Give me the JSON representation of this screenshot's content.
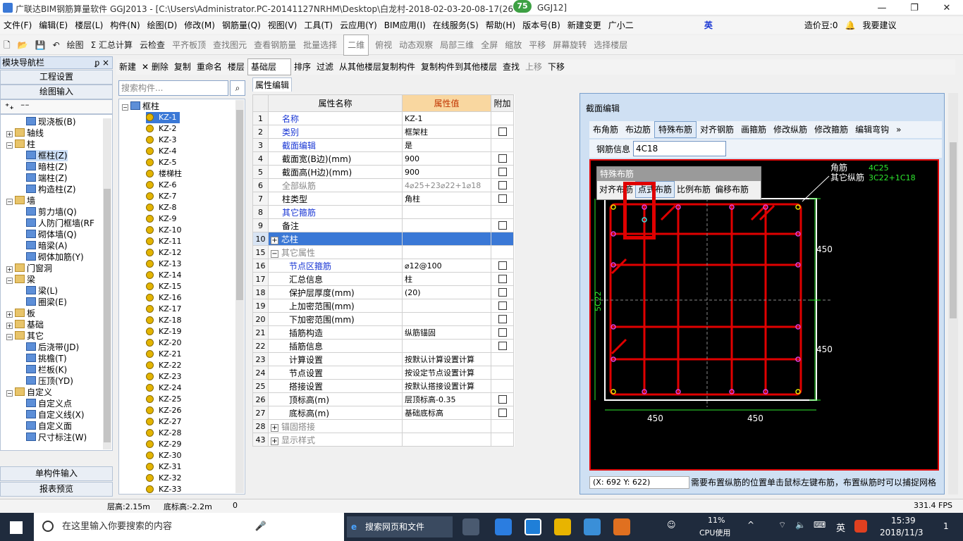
{
  "window": {
    "title": "广联达BIM钢筋算量软件 GGJ2013 - [C:\\Users\\Administrator.PC-20141127NRHM\\Desktop\\白龙村-2018-02-03-20-08-17(26",
    "title_tail": "GGJ12]",
    "badge": "75",
    "minimize": "—",
    "restore": "❐",
    "close": "✕"
  },
  "menu": [
    "文件(F)",
    "编辑(E)",
    "楼层(L)",
    "构件(N)",
    "绘图(D)",
    "修改(M)",
    "钢筋量(Q)",
    "视图(V)",
    "工具(T)",
    "云应用(Y)",
    "BIM应用(I)",
    "在线服务(S)",
    "帮助(H)",
    "版本号(B)",
    "新建变更",
    "广小二"
  ],
  "menu_right": {
    "ime": "英",
    "zao_jia_dou": "造价豆:0",
    "suggest": "我要建议"
  },
  "toolbar1": [
    "绘图",
    "Σ 汇总计算",
    "云检查",
    "平齐板顶",
    "查找图元",
    "查看钢筋量",
    "批量选择",
    "二维",
    "俯视",
    "动态观察",
    "局部三维",
    "全屏",
    "缩放",
    "平移",
    "屏幕旋转",
    "选择楼层"
  ],
  "left_panel": {
    "title": "模块导航栏",
    "pin": "ᵱ ×",
    "btn_project": "工程设置",
    "btn_draw": "绘图输入",
    "btn_single": "单构件输入",
    "btn_report": "报表预览",
    "tree": [
      {
        "label": "现浇板(B)",
        "indent": 2,
        "icon": "blue"
      },
      {
        "label": "轴线",
        "indent": 0,
        "toggle": "+",
        "icon": "folder"
      },
      {
        "label": "柱",
        "indent": 0,
        "toggle": "-",
        "icon": "folder"
      },
      {
        "label": "框柱(Z)",
        "indent": 2,
        "icon": "blue",
        "selected": true
      },
      {
        "label": "暗柱(Z)",
        "indent": 2,
        "icon": "blue"
      },
      {
        "label": "端柱(Z)",
        "indent": 2,
        "icon": "blue"
      },
      {
        "label": "构造柱(Z)",
        "indent": 2,
        "icon": "blue"
      },
      {
        "label": "墙",
        "indent": 0,
        "toggle": "-",
        "icon": "folder"
      },
      {
        "label": "剪力墙(Q)",
        "indent": 2,
        "icon": "blue"
      },
      {
        "label": "人防门框墙(RF",
        "indent": 2,
        "icon": "blue"
      },
      {
        "label": "砌体墙(Q)",
        "indent": 2,
        "icon": "blue"
      },
      {
        "label": "暗梁(A)",
        "indent": 2,
        "icon": "blue"
      },
      {
        "label": "砌体加筋(Y)",
        "indent": 2,
        "icon": "blue"
      },
      {
        "label": "门窗洞",
        "indent": 0,
        "toggle": "+",
        "icon": "folder"
      },
      {
        "label": "梁",
        "indent": 0,
        "toggle": "-",
        "icon": "folder"
      },
      {
        "label": "梁(L)",
        "indent": 2,
        "icon": "blue"
      },
      {
        "label": "圈梁(E)",
        "indent": 2,
        "icon": "blue"
      },
      {
        "label": "板",
        "indent": 0,
        "toggle": "+",
        "icon": "folder"
      },
      {
        "label": "基础",
        "indent": 0,
        "toggle": "+",
        "icon": "folder"
      },
      {
        "label": "其它",
        "indent": 0,
        "toggle": "-",
        "icon": "folder"
      },
      {
        "label": "后浇带(JD)",
        "indent": 2,
        "icon": "blue"
      },
      {
        "label": "挑檐(T)",
        "indent": 2,
        "icon": "blue"
      },
      {
        "label": "栏板(K)",
        "indent": 2,
        "icon": "blue"
      },
      {
        "label": "压顶(YD)",
        "indent": 2,
        "icon": "blue"
      },
      {
        "label": "自定义",
        "indent": 0,
        "toggle": "-",
        "icon": "folder"
      },
      {
        "label": "自定义点",
        "indent": 2,
        "icon": "blue"
      },
      {
        "label": "自定义线(X)",
        "indent": 2,
        "icon": "blue"
      },
      {
        "label": "自定义面",
        "indent": 2,
        "icon": "blue"
      },
      {
        "label": "尺寸标注(W)",
        "indent": 2,
        "icon": "blue"
      }
    ]
  },
  "toolbar2": [
    "新建",
    "✕ 删除",
    "复制",
    "重命名",
    "楼层",
    "基础层",
    "排序",
    "过滤",
    "从其他楼层复制构件",
    "复制构件到其他楼层",
    "查找",
    "上移",
    "下移"
  ],
  "component_search": {
    "placeholder": "搜索构件..."
  },
  "component_tree": {
    "root": "框柱",
    "items": [
      "KZ-1",
      "KZ-2",
      "KZ-3",
      "KZ-4",
      "KZ-5",
      "楼梯柱",
      "KZ-6",
      "KZ-7",
      "KZ-8",
      "KZ-9",
      "KZ-10",
      "KZ-11",
      "KZ-12",
      "KZ-13",
      "KZ-14",
      "KZ-15",
      "KZ-16",
      "KZ-17",
      "KZ-18",
      "KZ-19",
      "KZ-20",
      "KZ-21",
      "KZ-22",
      "KZ-23",
      "KZ-24",
      "KZ-25",
      "KZ-26",
      "KZ-27",
      "KZ-28",
      "KZ-29",
      "KZ-30",
      "KZ-31",
      "KZ-32",
      "KZ-33"
    ],
    "selected": "KZ-1"
  },
  "property_tab": "属性编辑",
  "property_table": {
    "headers": {
      "name": "属性名称",
      "value": "属性值",
      "extra": "附加"
    },
    "rows": [
      {
        "n": "1",
        "name": "名称",
        "value": "KZ-1",
        "style": "lk",
        "cb": false
      },
      {
        "n": "2",
        "name": "类别",
        "value": "框架柱",
        "style": "lk",
        "cb": true
      },
      {
        "n": "3",
        "name": "截面编辑",
        "value": "是",
        "style": "lk",
        "cb": false
      },
      {
        "n": "4",
        "name": "截面宽(B边)(mm)",
        "value": "900",
        "style": "",
        "cb": true
      },
      {
        "n": "5",
        "name": "截面高(H边)(mm)",
        "value": "900",
        "style": "",
        "cb": true
      },
      {
        "n": "6",
        "name": "全部纵筋",
        "value": "4⌀25+23⌀22+1⌀18",
        "style": "gr",
        "cb": true
      },
      {
        "n": "7",
        "name": "柱类型",
        "value": "角柱",
        "style": "",
        "cb": true
      },
      {
        "n": "8",
        "name": "其它箍筋",
        "value": "",
        "style": "lk",
        "cb": false
      },
      {
        "n": "9",
        "name": "备注",
        "value": "",
        "style": "",
        "cb": true
      },
      {
        "n": "10",
        "name": "芯柱",
        "value": "",
        "style": "hl",
        "plus": "+",
        "cb": false
      },
      {
        "n": "15",
        "name": "其它属性",
        "value": "",
        "style": "gr",
        "plus": "−",
        "cb": false
      },
      {
        "n": "16",
        "name": "节点区箍筋",
        "value": "⌀12@100",
        "style": "lk",
        "indent": true,
        "cb": true
      },
      {
        "n": "17",
        "name": "汇总信息",
        "value": "柱",
        "style": "",
        "indent": true,
        "cb": true
      },
      {
        "n": "18",
        "name": "保护层厚度(mm)",
        "value": "(20)",
        "style": "",
        "indent": true,
        "cb": true
      },
      {
        "n": "19",
        "name": "上加密范围(mm)",
        "value": "",
        "style": "",
        "indent": true,
        "cb": true
      },
      {
        "n": "20",
        "name": "下加密范围(mm)",
        "value": "",
        "style": "",
        "indent": true,
        "cb": true
      },
      {
        "n": "21",
        "name": "插筋构造",
        "value": "纵筋锚固",
        "style": "",
        "indent": true,
        "cb": true
      },
      {
        "n": "22",
        "name": "插筋信息",
        "value": "",
        "style": "",
        "indent": true,
        "cb": true
      },
      {
        "n": "23",
        "name": "计算设置",
        "value": "按默认计算设置计算",
        "style": "",
        "indent": true,
        "cb": false
      },
      {
        "n": "24",
        "name": "节点设置",
        "value": "按设定节点设置计算",
        "style": "",
        "indent": true,
        "cb": false
      },
      {
        "n": "25",
        "name": "搭接设置",
        "value": "按默认搭接设置计算",
        "style": "",
        "indent": true,
        "cb": false
      },
      {
        "n": "26",
        "name": "顶标高(m)",
        "value": "层顶标高-0.35",
        "style": "",
        "indent": true,
        "cb": true
      },
      {
        "n": "27",
        "name": "底标高(m)",
        "value": "基础底标高",
        "style": "",
        "indent": true,
        "cb": true
      },
      {
        "n": "28",
        "name": "锚固搭接",
        "value": "",
        "style": "gr",
        "plus": "+",
        "cb": false
      },
      {
        "n": "43",
        "name": "显示样式",
        "value": "",
        "style": "gr",
        "plus": "+",
        "cb": false
      }
    ]
  },
  "section_editor": {
    "title": "截面编辑",
    "tools": [
      "布角筋",
      "布边筋",
      "特殊布筋",
      "对齐钢筋",
      "画箍筋",
      "修改纵筋",
      "修改箍筋",
      "编辑弯钩"
    ],
    "active_tool": "特殊布筋",
    "rebar_label": "钢筋信息",
    "rebar_value": "4C18",
    "popup_title": "特殊布筋",
    "popup_items": [
      "对齐布筋",
      "点式布筋",
      "比例布筋",
      "偏移布筋"
    ],
    "legend_corner_label": "角筋",
    "legend_corner_value": "4C25",
    "legend_other_label": "其它纵筋",
    "legend_other_value": "3C22+1C18",
    "dim_top": "450",
    "dim_bottom": "450",
    "dim_left_v": "5C22",
    "dim_bot_1": "450",
    "dim_bot_2": "450",
    "coords": "(X: 692 Y: 622)",
    "hint": "需要布置纵筋的位置单击鼠标左键布筋，布置纵筋时可以捕捉网格"
  },
  "status": {
    "floor_h": "层高:2.15m",
    "bottom": "底标高:-2.2m",
    "zero": "0",
    "fps": "331.4 FPS"
  },
  "taskbar": {
    "search": "在这里输入你要搜索的内容",
    "browser_search": "搜索网页和文件",
    "cpu_pct": "11%",
    "cpu_label": "CPU使用",
    "ime": "英",
    "time": "15:39",
    "date": "2018/11/3",
    "notif": "1"
  }
}
